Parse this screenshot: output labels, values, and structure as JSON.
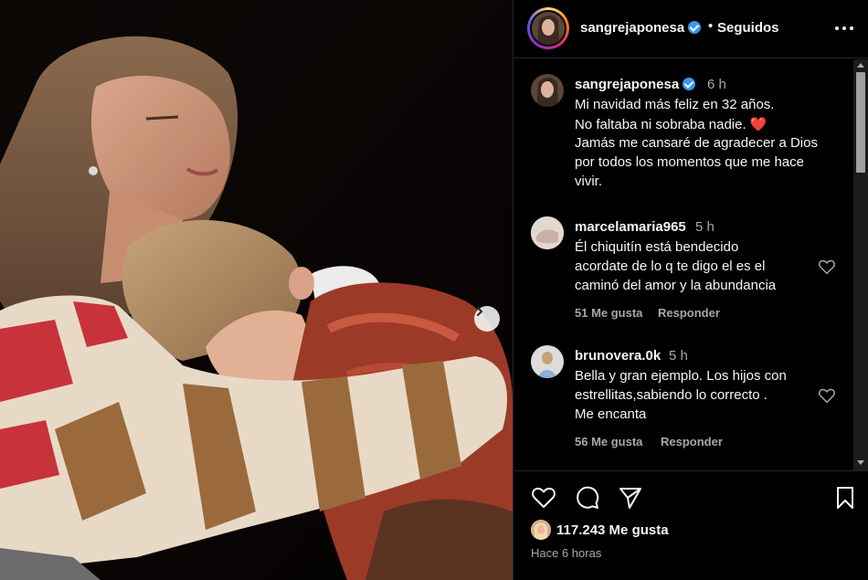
{
  "post": {
    "username": "sangrejaponesa",
    "verified": true,
    "follow_status": "Seguidos",
    "separator": "•",
    "photo_alt": "Mujer abrazando a un niño dormido"
  },
  "caption": {
    "username": "sangrejaponesa",
    "time": "6 h",
    "lines": [
      "Mi navidad más feliz en 32 años.",
      "No faltaba ni sobraba nadie.",
      "Jamás me cansaré de agradecer a Dios",
      "por todos los momentos que me hace",
      "vivir."
    ],
    "heart_emoji": "❤️"
  },
  "comments": [
    {
      "username": "marcelamaria965",
      "time": "5 h",
      "lines": [
        "Él chiquitín está bendecido",
        "acordate de lo q te digo el es el",
        "caminó del amor y la abundancia"
      ],
      "likes": "51 Me gusta",
      "reply": "Responder"
    },
    {
      "username": "brunovera.0k",
      "time": "5 h",
      "lines": [
        "Bella y gran ejemplo. Los hijos con",
        "estrellitas,sabiendo lo correcto .",
        "Me encanta"
      ],
      "likes": "56 Me gusta",
      "reply": "Responder"
    }
  ],
  "footer": {
    "likes": "117.243 Me gusta",
    "time_ago": "Hace 6 horas"
  },
  "icons": [
    "heart-icon",
    "comment-icon",
    "share-icon",
    "bookmark-icon",
    "more-icon",
    "chevron-right-icon"
  ],
  "colors": {
    "background": "#000000",
    "text": "#f5f5f5",
    "secondary_text": "#a8a8a8",
    "verified": "#3897f0",
    "heart_emoji": "#ed4956"
  }
}
